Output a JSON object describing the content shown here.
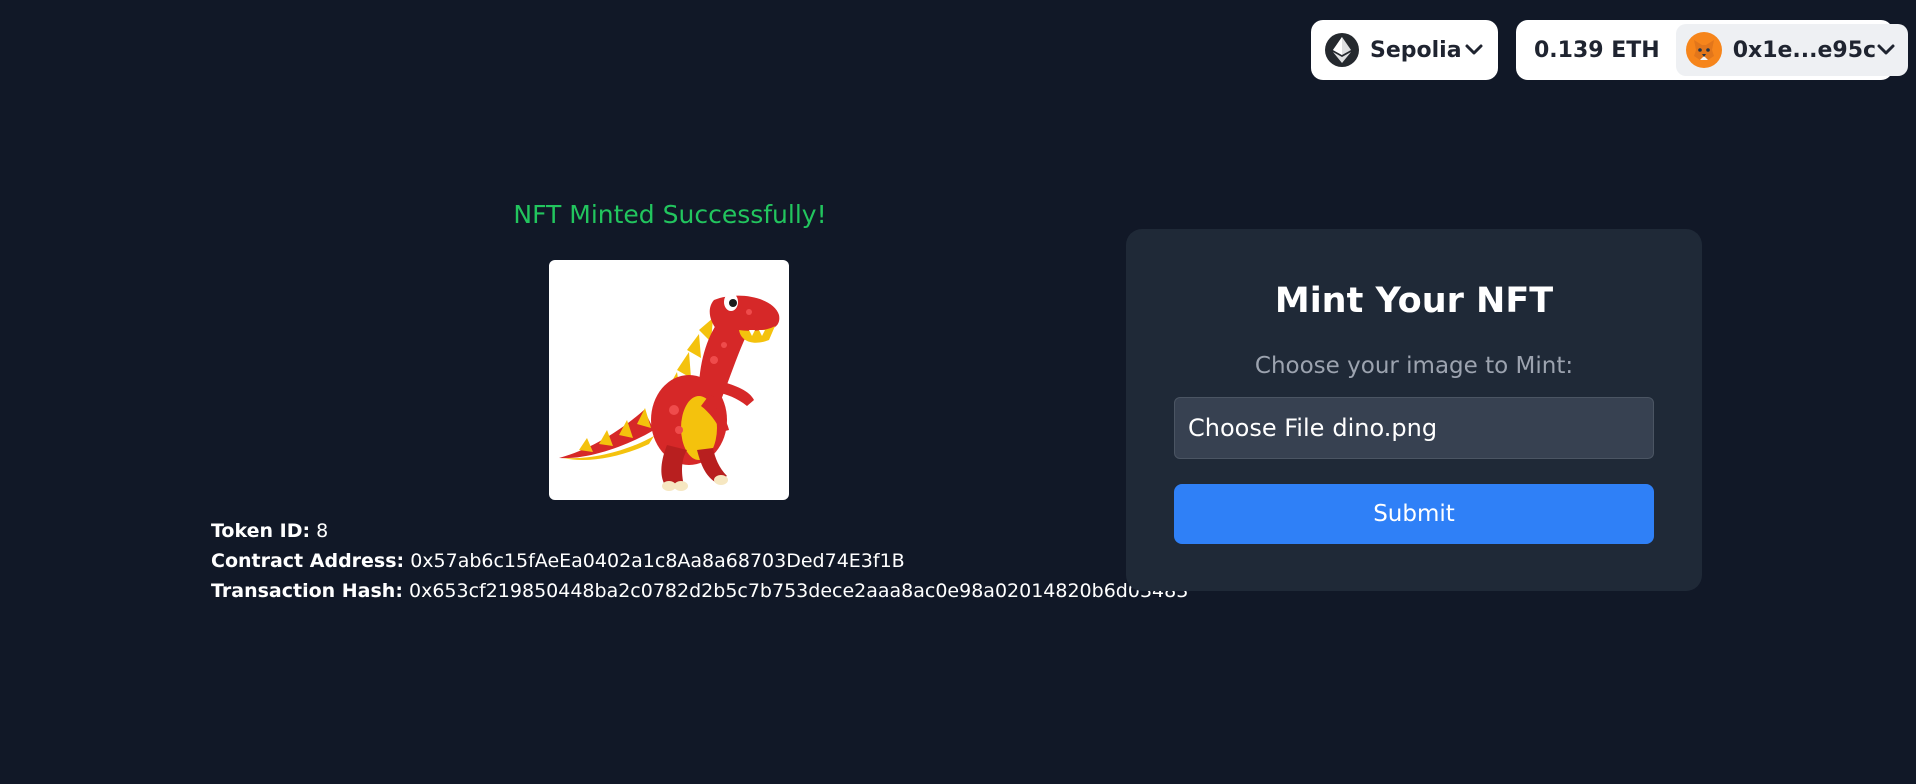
{
  "header": {
    "network": {
      "name": "Sepolia",
      "icon": "ethereum-icon"
    },
    "account": {
      "balance": "0.139 ETH",
      "address": "0x1e...e95c",
      "avatar_icon": "metamask-fox-icon"
    }
  },
  "result": {
    "title": "NFT Minted Successfully!",
    "image_alt": "dino-nft-image",
    "token_id_label": "Token ID:",
    "token_id": "8",
    "contract_label": "Contract Address:",
    "contract_address": "0x57ab6c15fAeEa0402a1c8Aa8a68703Ded74E3f1B",
    "tx_label": "Transaction Hash:",
    "tx_hash": "0x653cf219850448ba2c0782d2b5c7b753dece2aaa8ac0e98a02014820b6d03483"
  },
  "mint": {
    "title": "Mint Your NFT",
    "subtitle": "Choose your image to Mint:",
    "file_button": "Choose File",
    "file_name": "dino.png",
    "submit_label": "Submit"
  },
  "colors": {
    "background": "#111827",
    "success": "#22c55e",
    "card": "#1f2937",
    "accent": "#2f80f7"
  }
}
